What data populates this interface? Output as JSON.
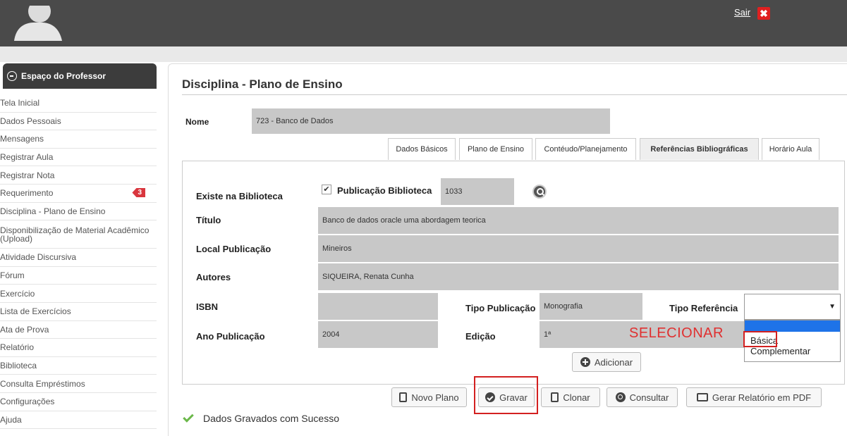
{
  "header": {
    "logout_label": "Sair",
    "logout_icon": "close-icon",
    "accent": "#e02020"
  },
  "sidebar": {
    "title": "Espaço do Professor",
    "items": [
      {
        "label": "Tela Inicial"
      },
      {
        "label": "Dados Pessoais"
      },
      {
        "label": "Mensagens"
      },
      {
        "label": "Registrar Aula"
      },
      {
        "label": "Registrar Nota"
      },
      {
        "label": "Requerimento",
        "badge": "3"
      },
      {
        "label": "Disciplina - Plano de Ensino"
      },
      {
        "label": "Disponibilização de Material Acadêmico (Upload)"
      },
      {
        "label": "Atividade Discursiva"
      },
      {
        "label": "Fórum"
      },
      {
        "label": "Exercício"
      },
      {
        "label": "Lista de Exercícios"
      },
      {
        "label": "Ata de Prova"
      },
      {
        "label": "Relatório"
      },
      {
        "label": "Biblioteca"
      },
      {
        "label": "Consulta Empréstimos"
      },
      {
        "label": "Configurações"
      },
      {
        "label": "Ajuda"
      }
    ]
  },
  "main": {
    "title": "Disciplina - Plano de Ensino",
    "nome_label": "Nome",
    "nome_value": "723 - Banco de Dados",
    "tabs": [
      {
        "label": "Dados Básicos"
      },
      {
        "label": "Plano de Ensino"
      },
      {
        "label": "Contéudo/Planejamento"
      },
      {
        "label": "Referências Bibliográficas",
        "active": true
      },
      {
        "label": "Horário Aula"
      }
    ]
  },
  "form": {
    "existe_label": "Existe na Biblioteca",
    "checkbox_checked": true,
    "publicacao_label": "Publicação Biblioteca",
    "publicacao_value": "1033",
    "titulo_label": "Título",
    "titulo_value": "Banco de dados oracle uma abordagem teorica",
    "local_label": "Local Publicação",
    "local_value": "Mineiros",
    "autores_label": "Autores",
    "autores_value": "SIQUEIRA, Renata Cunha",
    "isbn_label": "ISBN",
    "isbn_value": "",
    "tipo_pub_label": "Tipo Publicação",
    "tipo_pub_value": "Monografia",
    "tipo_ref_label": "Tipo Referência",
    "tipo_ref_value": "",
    "tipo_ref_options": [
      "Básica",
      "Complementar"
    ],
    "ano_label": "Ano Publicação",
    "ano_value": "2004",
    "edicao_label": "Edição",
    "edicao_value": "1ª",
    "adicionar_label": "Adicionar",
    "annotation": "SELECIONAR"
  },
  "actions": {
    "novo_plano": "Novo Plano",
    "gravar": "Gravar",
    "clonar": "Clonar",
    "consultar": "Consultar",
    "gerar_pdf": "Gerar Relatório em PDF"
  },
  "status": {
    "message": "Dados Gravados com Sucesso",
    "color": "#6bb84a"
  }
}
